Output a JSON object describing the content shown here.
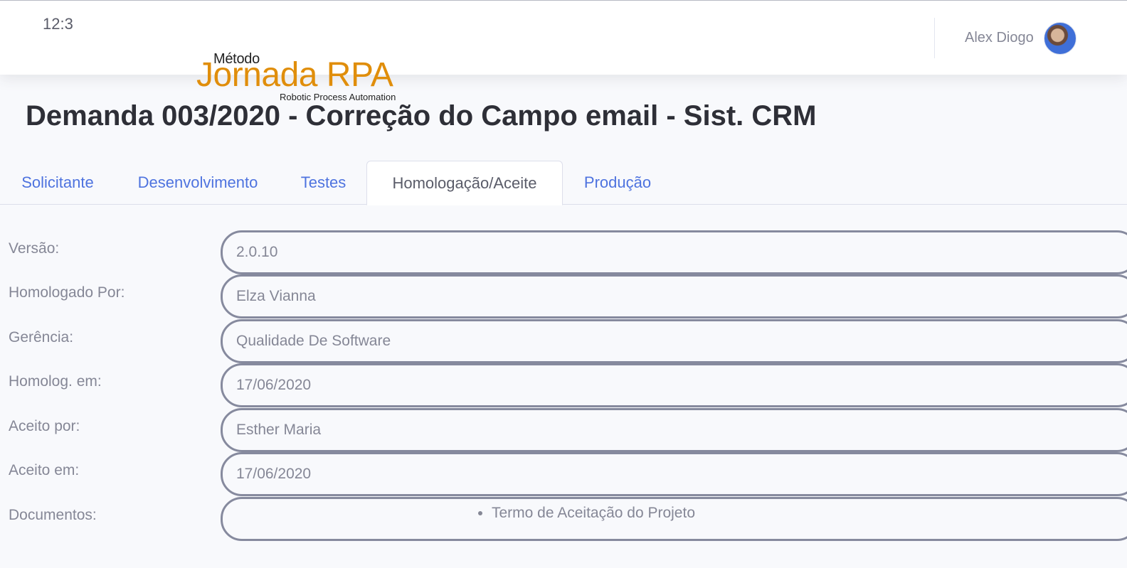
{
  "header": {
    "clock": "12:3",
    "user_name": "Alex Diogo",
    "logo": {
      "top_text": "Método",
      "main_text": "Jornada RPA",
      "sub_text": "Robotic Process Automation"
    }
  },
  "page": {
    "title": "Demanda 003/2020 - Correção do Campo email - Sist. CRM"
  },
  "tabs": [
    {
      "label": "Solicitante",
      "active": false
    },
    {
      "label": "Desenvolvimento",
      "active": false
    },
    {
      "label": "Testes",
      "active": false
    },
    {
      "label": "Homologação/Aceite",
      "active": true
    },
    {
      "label": "Produção",
      "active": false
    }
  ],
  "form": {
    "versao": {
      "label": "Versão:",
      "value": "2.0.10"
    },
    "homologado_por": {
      "label": "Homologado Por:",
      "value": "Elza Vianna"
    },
    "gerencia": {
      "label": "Gerência:",
      "value": "Qualidade De Software"
    },
    "homolog_em": {
      "label": "Homolog. em:",
      "value": "17/06/2020"
    },
    "aceito_por": {
      "label": "Aceito por:",
      "value": "Esther Maria"
    },
    "aceito_em": {
      "label": "Aceito em:",
      "value": "17/06/2020"
    },
    "documentos": {
      "label": "Documentos:",
      "items": [
        "Termo de Aceitação do Projeto"
      ]
    }
  },
  "colors": {
    "accent": "#4e73df",
    "logo_orange": "#e08e0b",
    "field_border": "#868a9e",
    "background": "#f8f9fc"
  }
}
